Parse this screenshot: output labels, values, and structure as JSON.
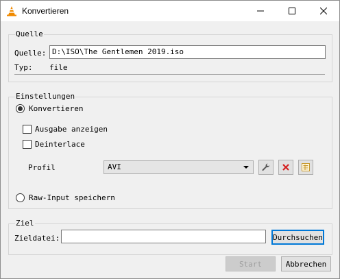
{
  "window": {
    "title": "Konvertieren"
  },
  "source": {
    "group_title": "Quelle",
    "source_label": "Quelle:",
    "source_value": "D:\\ISO\\The Gentlemen 2019.iso",
    "type_label": "Typ:",
    "type_value": "file"
  },
  "settings": {
    "group_title": "Einstellungen",
    "convert_label": "Konvertieren",
    "convert_selected": true,
    "show_output_label": "Ausgabe anzeigen",
    "deinterlace_label": "Deinterlace",
    "profile_label": "Profil",
    "profile_value": "AVI",
    "raw_input_label": "Raw-Input speichern"
  },
  "target": {
    "group_title": "Ziel",
    "file_label": "Zieldatei:",
    "file_value": "",
    "browse_label": "Durchsuchen"
  },
  "actions": {
    "start_label": "Start",
    "cancel_label": "Abbrechen"
  },
  "colors": {
    "accent": "#0078d7",
    "delete_red": "#d42020",
    "vlc_orange": "#f08a00"
  }
}
